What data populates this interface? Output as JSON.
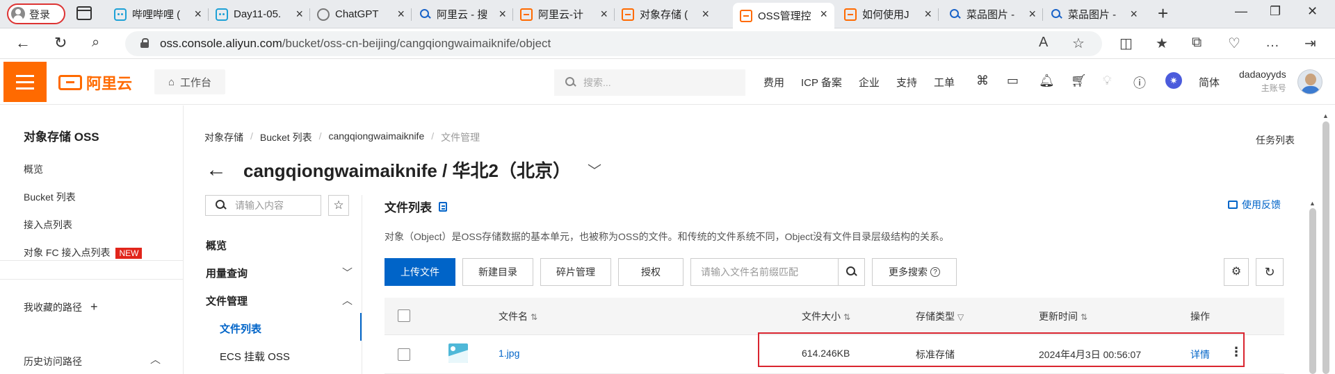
{
  "browser": {
    "profile_label": "登录",
    "tabs": [
      {
        "title": "哔哩哔哩 (",
        "icon": "bilibili-icon"
      },
      {
        "title": "Day11-05.",
        "icon": "bilibili-icon"
      },
      {
        "title": "ChatGPT",
        "icon": "chatgpt-icon"
      },
      {
        "title": "阿里云 - 搜",
        "icon": "search-icon"
      },
      {
        "title": "阿里云-计",
        "icon": "aliyun-icon"
      },
      {
        "title": "对象存储 (",
        "icon": "aliyun-icon"
      },
      {
        "title": "OSS管理控",
        "icon": "aliyun-icon"
      },
      {
        "title": "如何使用J",
        "icon": "aliyun-icon"
      },
      {
        "title": "菜品图片 -",
        "icon": "search-icon"
      },
      {
        "title": "菜品图片 -",
        "icon": "search-icon"
      }
    ],
    "active_tab_index": 6,
    "url_host": "oss.console.aliyun.com",
    "url_path": "/bucket/oss-cn-beijing/cangqiongwaimaiknife/object"
  },
  "header": {
    "logo_text": "阿里云",
    "workbench": "工作台",
    "search_placeholder": "搜索...",
    "links": [
      "费用",
      "ICP 备案",
      "企业",
      "支持",
      "工单"
    ],
    "lang": "简体",
    "username": "dadaoyyds",
    "account_type": "主账号"
  },
  "sidebar": {
    "title": "对象存储 OSS",
    "items": [
      "概览",
      "Bucket 列表",
      "接入点列表",
      "对象 FC 接入点列表"
    ],
    "new_badge": "NEW",
    "favorites": "我收藏的路径",
    "history": "历史访问路径"
  },
  "breadcrumb": [
    "对象存储",
    "Bucket 列表",
    "cangqiongwaimaiknife",
    "文件管理"
  ],
  "task_list": "任务列表",
  "page_title": "cangqiongwaimaiknife / 华北2（北京）",
  "bucket_nav": {
    "search_placeholder": "请输入内容",
    "items": [
      {
        "label": "概览"
      },
      {
        "label": "用量查询"
      },
      {
        "label": "文件管理"
      },
      {
        "label": "文件列表"
      },
      {
        "label": "ECS 挂载 OSS"
      }
    ]
  },
  "file_list": {
    "title": "文件列表",
    "feedback": "使用反馈",
    "description": "对象（Object）是OSS存储数据的基本单元，也被称为OSS的文件。和传统的文件系统不同，Object没有文件目录层级结构的关系。",
    "buttons": {
      "upload": "上传文件",
      "new_dir": "新建目录",
      "fragments": "碎片管理",
      "authorize": "授权",
      "more_search": "更多搜索"
    },
    "filter_placeholder": "请输入文件名前缀匹配",
    "columns": [
      "文件名",
      "文件大小",
      "存储类型",
      "更新时间",
      "操作"
    ],
    "rows": [
      {
        "name": "1.jpg",
        "size": "614.246KB",
        "storage": "标准存储",
        "updated": "2024年4月3日 00:56:07",
        "action": "详情"
      }
    ]
  },
  "colors": {
    "brand": "#ff6a00",
    "primary": "#0064c8",
    "highlight": "#d9242f"
  }
}
